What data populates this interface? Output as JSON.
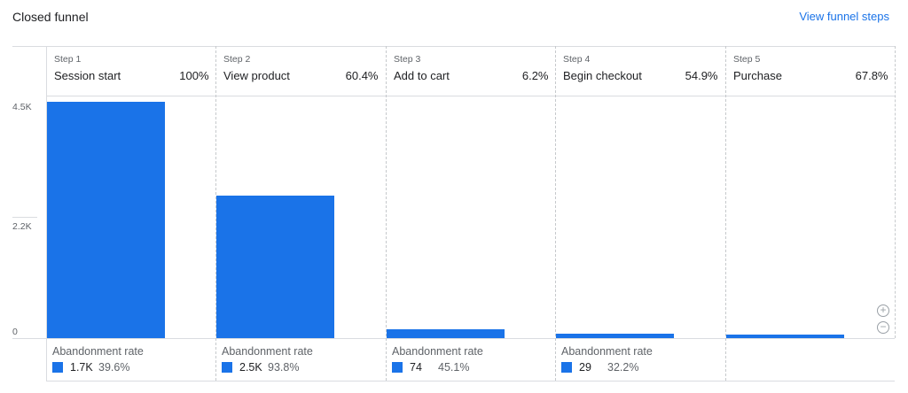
{
  "header": {
    "title": "Closed funnel",
    "link": "View funnel steps"
  },
  "chart_data": {
    "type": "bar",
    "y_ticks": [
      "4.5K",
      "2.2K",
      "0"
    ],
    "ylim": [
      0,
      4500
    ],
    "steps": [
      {
        "step": "Step 1",
        "name": "Session start",
        "pct": "100%",
        "value": 4500,
        "abandon_label": "Abandonment rate",
        "abandon_count": "1.7K",
        "abandon_rate": "39.6%"
      },
      {
        "step": "Step 2",
        "name": "View product",
        "pct": "60.4%",
        "value": 2720,
        "abandon_label": "Abandonment rate",
        "abandon_count": "2.5K",
        "abandon_rate": "93.8%"
      },
      {
        "step": "Step 3",
        "name": "Add to cart",
        "pct": "6.2%",
        "value": 168,
        "abandon_label": "Abandonment rate",
        "abandon_count": "74",
        "abandon_rate": "45.1%"
      },
      {
        "step": "Step 4",
        "name": "Begin checkout",
        "pct": "54.9%",
        "value": 92,
        "abandon_label": "Abandonment rate",
        "abandon_count": "29",
        "abandon_rate": "32.2%"
      },
      {
        "step": "Step 5",
        "name": "Purchase",
        "pct": "67.8%",
        "value": 62
      }
    ]
  },
  "zoom": {
    "in_icon": "zoom-in-icon",
    "out_icon": "zoom-out-icon"
  }
}
